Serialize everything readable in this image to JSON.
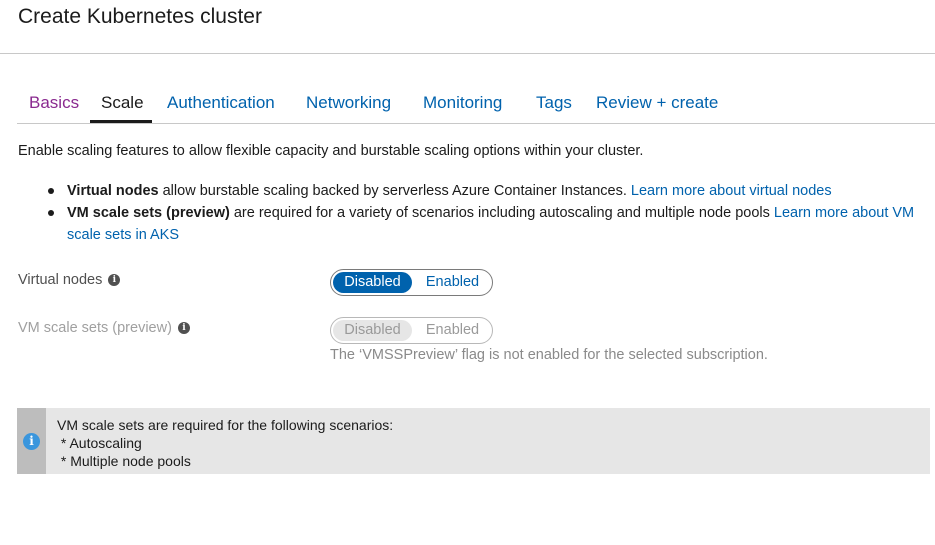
{
  "page": {
    "title": "Create Kubernetes cluster"
  },
  "tabs": [
    {
      "label": "Basics",
      "state": "visited"
    },
    {
      "label": "Scale",
      "state": "active"
    },
    {
      "label": "Authentication",
      "state": "default"
    },
    {
      "label": "Networking",
      "state": "default"
    },
    {
      "label": "Monitoring",
      "state": "default"
    },
    {
      "label": "Tags",
      "state": "default"
    },
    {
      "label": "Review + create",
      "state": "default"
    }
  ],
  "intro": "Enable scaling features to allow flexible capacity and burstable scaling options within your cluster.",
  "bullets": [
    {
      "bold": "Virtual nodes",
      "text": " allow burstable scaling backed by serverless Azure Container Instances. ",
      "link": "Learn more about virtual nodes"
    },
    {
      "bold": "VM scale sets (preview)",
      "text": " are required for a variety of scenarios including autoscaling and multiple node pools ",
      "link": "Learn more about VM scale sets in AKS"
    }
  ],
  "fields": {
    "virtual_nodes": {
      "label": "Virtual nodes",
      "options": [
        "Disabled",
        "Enabled"
      ],
      "selected": "Disabled",
      "enabled": true
    },
    "vm_scale_sets": {
      "label": "VM scale sets (preview)",
      "options": [
        "Disabled",
        "Enabled"
      ],
      "selected": "Disabled",
      "enabled": false,
      "note": "The ‘VMSSPreview’ flag is not enabled for the selected subscription."
    }
  },
  "infobox": {
    "line1": "VM scale sets are required for the following scenarios:",
    "line2": " * Autoscaling",
    "line3": " * Multiple node pools"
  },
  "colors": {
    "link": "#0062ad",
    "visited_tab": "#8a2a8f",
    "toggle_selected": "#0062ad",
    "info_icon": "#3a96dd"
  }
}
